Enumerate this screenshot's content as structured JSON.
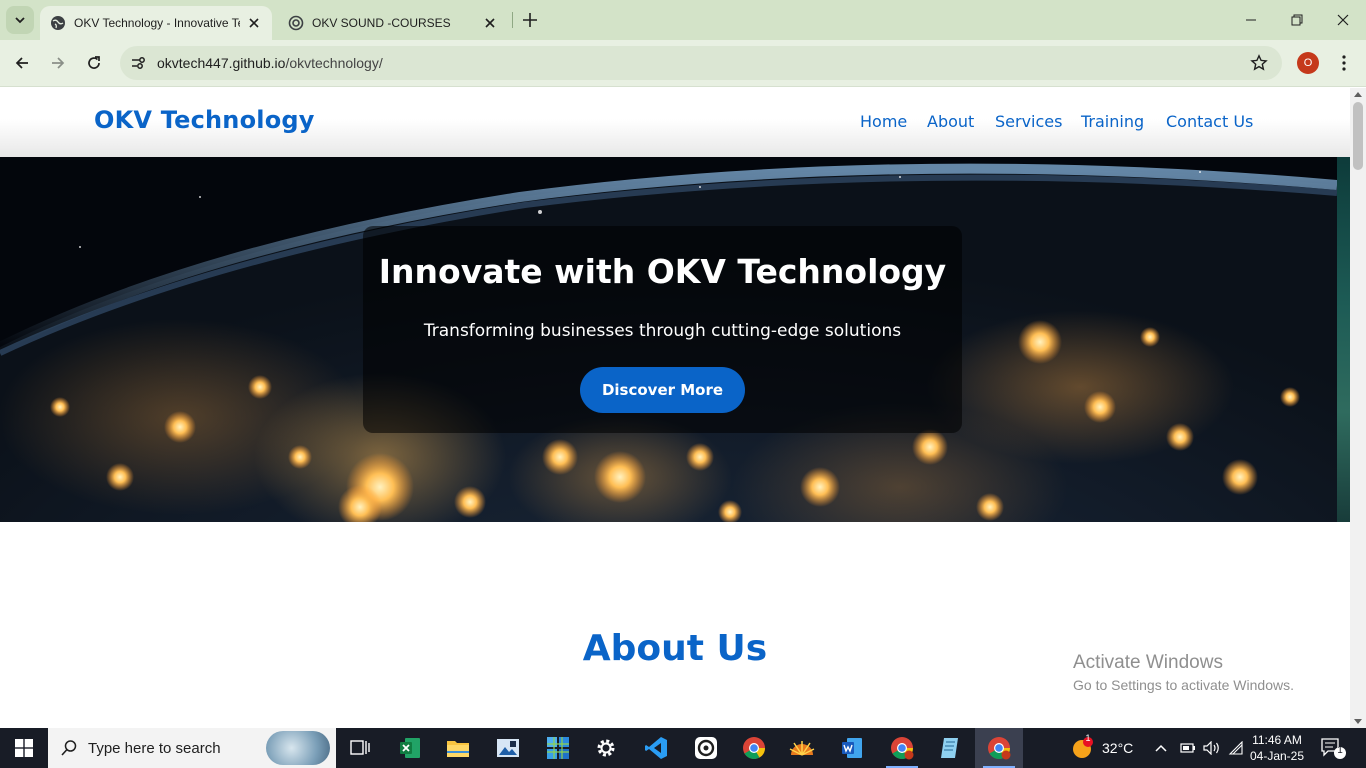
{
  "browser": {
    "tabs": [
      {
        "title": "OKV Technology - Innovative Te",
        "active": true
      },
      {
        "title": "OKV SOUND -COURSES",
        "active": false
      }
    ],
    "url_host": "okvtech447.github.io",
    "url_path": "/okvtechnology/",
    "profile_initial": "O"
  },
  "site": {
    "brand": "OKV Technology",
    "nav": [
      "Home",
      "About",
      "Services",
      "Training",
      "Contact Us"
    ],
    "hero": {
      "title": "Innovate with OKV Technology",
      "subtitle": "Transforming businesses through cutting-edge solutions",
      "button": "Discover More"
    },
    "about_title": "About Us"
  },
  "watermark": {
    "line1": "Activate Windows",
    "line2": "Go to Settings to activate Windows."
  },
  "taskbar": {
    "search_placeholder": "Type here to search",
    "apps": [
      "task-view",
      "excel",
      "file-explorer",
      "photos-app",
      "windows-app",
      "settings",
      "vscode",
      "obs-app",
      "chrome",
      "sun-app",
      "word",
      "chrome-profile",
      "notepad-app",
      "chrome-active"
    ],
    "weather": "32°C",
    "weather_badge": "1",
    "time": "11:46 AM",
    "date": "04-Jan-25",
    "notification_count": "1"
  },
  "colors": {
    "brand_blue": "#0a64c8",
    "tabbar": "#d3e3c8",
    "taskbar": "#181c26"
  }
}
